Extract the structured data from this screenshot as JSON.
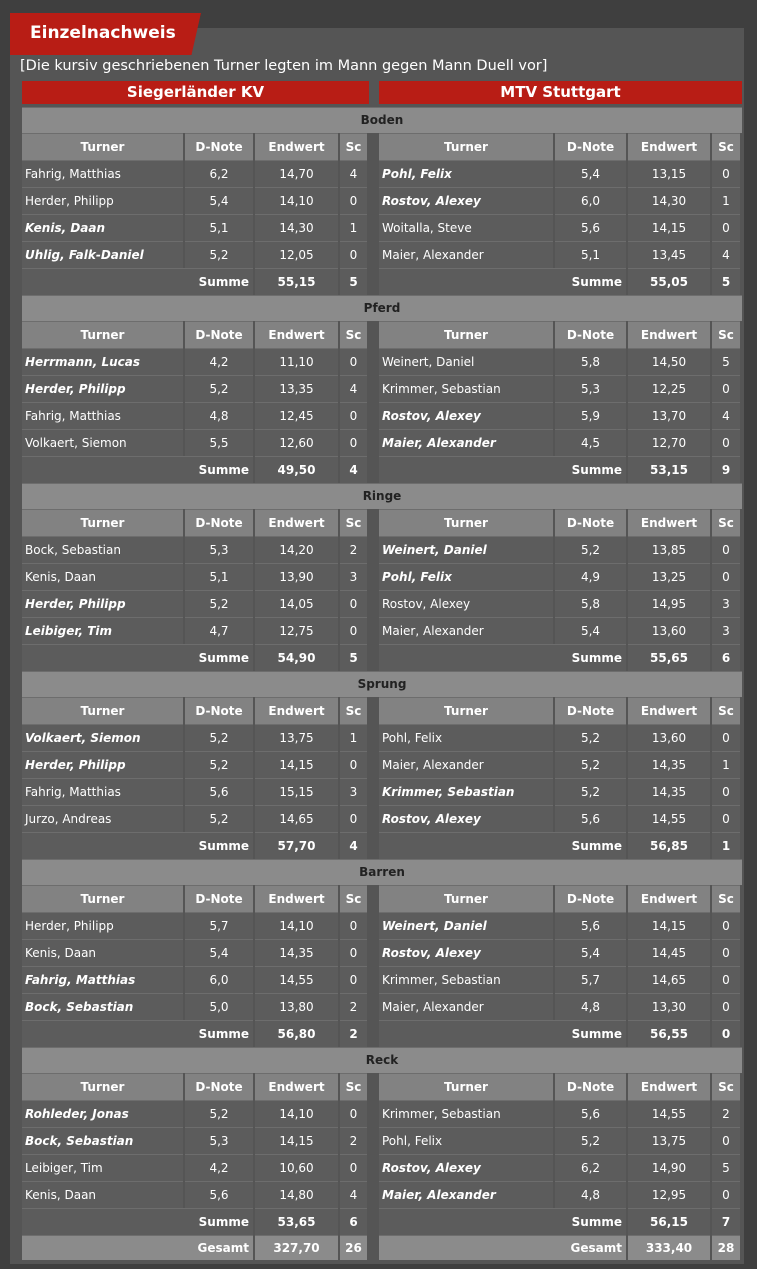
{
  "title": "Einzelnachweis",
  "note": "[Die kursiv geschriebenen Turner legten im Mann gegen Mann Duell vor]",
  "teams": {
    "left": "Siegerländer KV",
    "right": "MTV Stuttgart"
  },
  "columns": [
    "Turner",
    "D-Note",
    "Endwert",
    "Sc"
  ],
  "sum_label": "Summe",
  "total_label": "Gesamt",
  "apparatus": [
    {
      "name": "Boden",
      "left": [
        {
          "name": "Fahrig, Matthias",
          "d": "6,2",
          "e": "14,70",
          "sc": "4",
          "italic": false
        },
        {
          "name": "Herder, Philipp",
          "d": "5,4",
          "e": "14,10",
          "sc": "0",
          "italic": false
        },
        {
          "name": "Kenis, Daan",
          "d": "5,1",
          "e": "14,30",
          "sc": "1",
          "italic": true
        },
        {
          "name": "Uhlig, Falk-Daniel",
          "d": "5,2",
          "e": "12,05",
          "sc": "0",
          "italic": true
        }
      ],
      "right": [
        {
          "name": "Pohl, Felix",
          "d": "5,4",
          "e": "13,15",
          "sc": "0",
          "italic": true
        },
        {
          "name": "Rostov, Alexey",
          "d": "6,0",
          "e": "14,30",
          "sc": "1",
          "italic": true
        },
        {
          "name": "Woitalla, Steve",
          "d": "5,6",
          "e": "14,15",
          "sc": "0",
          "italic": false
        },
        {
          "name": "Maier, Alexander",
          "d": "5,1",
          "e": "13,45",
          "sc": "4",
          "italic": false
        }
      ],
      "left_sum": {
        "e": "55,15",
        "sc": "5"
      },
      "right_sum": {
        "e": "55,05",
        "sc": "5"
      }
    },
    {
      "name": "Pferd",
      "left": [
        {
          "name": "Herrmann, Lucas",
          "d": "4,2",
          "e": "11,10",
          "sc": "0",
          "italic": true
        },
        {
          "name": "Herder, Philipp",
          "d": "5,2",
          "e": "13,35",
          "sc": "4",
          "italic": true
        },
        {
          "name": "Fahrig, Matthias",
          "d": "4,8",
          "e": "12,45",
          "sc": "0",
          "italic": false
        },
        {
          "name": "Volkaert, Siemon",
          "d": "5,5",
          "e": "12,60",
          "sc": "0",
          "italic": false
        }
      ],
      "right": [
        {
          "name": "Weinert, Daniel",
          "d": "5,8",
          "e": "14,50",
          "sc": "5",
          "italic": false
        },
        {
          "name": "Krimmer, Sebastian",
          "d": "5,3",
          "e": "12,25",
          "sc": "0",
          "italic": false
        },
        {
          "name": "Rostov, Alexey",
          "d": "5,9",
          "e": "13,70",
          "sc": "4",
          "italic": true
        },
        {
          "name": "Maier, Alexander",
          "d": "4,5",
          "e": "12,70",
          "sc": "0",
          "italic": true
        }
      ],
      "left_sum": {
        "e": "49,50",
        "sc": "4"
      },
      "right_sum": {
        "e": "53,15",
        "sc": "9"
      }
    },
    {
      "name": "Ringe",
      "left": [
        {
          "name": "Bock, Sebastian",
          "d": "5,3",
          "e": "14,20",
          "sc": "2",
          "italic": false
        },
        {
          "name": "Kenis, Daan",
          "d": "5,1",
          "e": "13,90",
          "sc": "3",
          "italic": false
        },
        {
          "name": "Herder, Philipp",
          "d": "5,2",
          "e": "14,05",
          "sc": "0",
          "italic": true
        },
        {
          "name": "Leibiger, Tim",
          "d": "4,7",
          "e": "12,75",
          "sc": "0",
          "italic": true
        }
      ],
      "right": [
        {
          "name": "Weinert, Daniel",
          "d": "5,2",
          "e": "13,85",
          "sc": "0",
          "italic": true
        },
        {
          "name": "Pohl, Felix",
          "d": "4,9",
          "e": "13,25",
          "sc": "0",
          "italic": true
        },
        {
          "name": "Rostov, Alexey",
          "d": "5,8",
          "e": "14,95",
          "sc": "3",
          "italic": false
        },
        {
          "name": "Maier, Alexander",
          "d": "5,4",
          "e": "13,60",
          "sc": "3",
          "italic": false
        }
      ],
      "left_sum": {
        "e": "54,90",
        "sc": "5"
      },
      "right_sum": {
        "e": "55,65",
        "sc": "6"
      }
    },
    {
      "name": "Sprung",
      "left": [
        {
          "name": "Volkaert, Siemon",
          "d": "5,2",
          "e": "13,75",
          "sc": "1",
          "italic": true
        },
        {
          "name": "Herder, Philipp",
          "d": "5,2",
          "e": "14,15",
          "sc": "0",
          "italic": true
        },
        {
          "name": "Fahrig, Matthias",
          "d": "5,6",
          "e": "15,15",
          "sc": "3",
          "italic": false
        },
        {
          "name": "Jurzo, Andreas",
          "d": "5,2",
          "e": "14,65",
          "sc": "0",
          "italic": false
        }
      ],
      "right": [
        {
          "name": "Pohl, Felix",
          "d": "5,2",
          "e": "13,60",
          "sc": "0",
          "italic": false
        },
        {
          "name": "Maier, Alexander",
          "d": "5,2",
          "e": "14,35",
          "sc": "1",
          "italic": false
        },
        {
          "name": "Krimmer, Sebastian",
          "d": "5,2",
          "e": "14,35",
          "sc": "0",
          "italic": true
        },
        {
          "name": "Rostov, Alexey",
          "d": "5,6",
          "e": "14,55",
          "sc": "0",
          "italic": true
        }
      ],
      "left_sum": {
        "e": "57,70",
        "sc": "4"
      },
      "right_sum": {
        "e": "56,85",
        "sc": "1"
      }
    },
    {
      "name": "Barren",
      "left": [
        {
          "name": "Herder, Philipp",
          "d": "5,7",
          "e": "14,10",
          "sc": "0",
          "italic": false
        },
        {
          "name": "Kenis, Daan",
          "d": "5,4",
          "e": "14,35",
          "sc": "0",
          "italic": false
        },
        {
          "name": "Fahrig, Matthias",
          "d": "6,0",
          "e": "14,55",
          "sc": "0",
          "italic": true
        },
        {
          "name": "Bock, Sebastian",
          "d": "5,0",
          "e": "13,80",
          "sc": "2",
          "italic": true
        }
      ],
      "right": [
        {
          "name": "Weinert, Daniel",
          "d": "5,6",
          "e": "14,15",
          "sc": "0",
          "italic": true
        },
        {
          "name": "Rostov, Alexey",
          "d": "5,4",
          "e": "14,45",
          "sc": "0",
          "italic": true
        },
        {
          "name": "Krimmer, Sebastian",
          "d": "5,7",
          "e": "14,65",
          "sc": "0",
          "italic": false
        },
        {
          "name": "Maier, Alexander",
          "d": "4,8",
          "e": "13,30",
          "sc": "0",
          "italic": false
        }
      ],
      "left_sum": {
        "e": "56,80",
        "sc": "2"
      },
      "right_sum": {
        "e": "56,55",
        "sc": "0"
      }
    },
    {
      "name": "Reck",
      "left": [
        {
          "name": "Rohleder, Jonas",
          "d": "5,2",
          "e": "14,10",
          "sc": "0",
          "italic": true
        },
        {
          "name": "Bock, Sebastian",
          "d": "5,3",
          "e": "14,15",
          "sc": "2",
          "italic": true
        },
        {
          "name": "Leibiger, Tim",
          "d": "4,2",
          "e": "10,60",
          "sc": "0",
          "italic": false
        },
        {
          "name": "Kenis, Daan",
          "d": "5,6",
          "e": "14,80",
          "sc": "4",
          "italic": false
        }
      ],
      "right": [
        {
          "name": "Krimmer, Sebastian",
          "d": "5,6",
          "e": "14,55",
          "sc": "2",
          "italic": false
        },
        {
          "name": "Pohl, Felix",
          "d": "5,2",
          "e": "13,75",
          "sc": "0",
          "italic": false
        },
        {
          "name": "Rostov, Alexey",
          "d": "6,2",
          "e": "14,90",
          "sc": "5",
          "italic": true
        },
        {
          "name": "Maier, Alexander",
          "d": "4,8",
          "e": "12,95",
          "sc": "0",
          "italic": true
        }
      ],
      "left_sum": {
        "e": "53,65",
        "sc": "6"
      },
      "right_sum": {
        "e": "56,15",
        "sc": "7"
      }
    }
  ],
  "total": {
    "left": {
      "e": "327,70",
      "sc": "26"
    },
    "right": {
      "e": "333,40",
      "sc": "28"
    }
  }
}
